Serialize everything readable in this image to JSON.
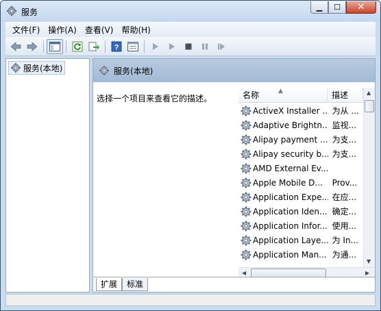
{
  "window": {
    "title": "服务",
    "app_icon": "gear-icon"
  },
  "menu": [
    "文件(F)",
    "操作(A)",
    "查看(V)",
    "帮助(H)"
  ],
  "tree": {
    "root_label": "服务(本地)"
  },
  "panel": {
    "header_title": "服务(本地)",
    "description_prompt": "选择一个项目来查看它的描述。"
  },
  "list": {
    "columns": {
      "name": "名称",
      "description": "描述"
    },
    "rows": [
      {
        "name": "ActiveX Installer ...",
        "description": "为从 ..."
      },
      {
        "name": "Adaptive Brightn...",
        "description": "监视..."
      },
      {
        "name": "Alipay payment ...",
        "description": "为支..."
      },
      {
        "name": "Alipay security b...",
        "description": "为支..."
      },
      {
        "name": "AMD External Ev...",
        "description": ""
      },
      {
        "name": "Apple Mobile D...",
        "description": "Prov..."
      },
      {
        "name": "Application Expe...",
        "description": "在应..."
      },
      {
        "name": "Application Iden...",
        "description": "确定..."
      },
      {
        "name": "Application Infor...",
        "description": "使用..."
      },
      {
        "name": "Application Laye...",
        "description": "为 In..."
      },
      {
        "name": "Application Man...",
        "description": "为通..."
      }
    ]
  },
  "tabs": [
    {
      "label": "扩展",
      "active": true
    },
    {
      "label": "标准",
      "active": false
    }
  ],
  "colors": {
    "accent": "#3a63a8",
    "title_bg": "#c9dcf0",
    "close": "#c9442c"
  }
}
